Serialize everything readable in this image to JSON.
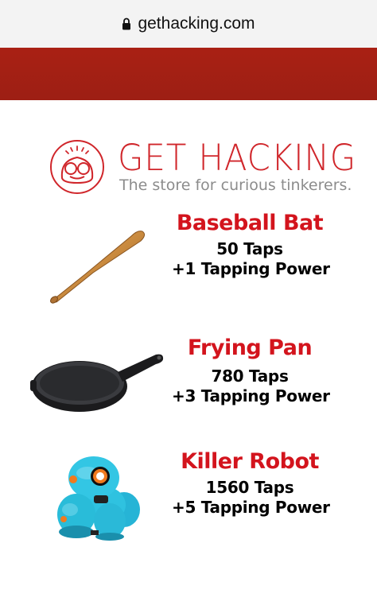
{
  "browser": {
    "url": "gethacking.com",
    "lock_icon": "lock-icon"
  },
  "header": {
    "bar_color": "#a21f15"
  },
  "logo": {
    "title": "GET HACKING",
    "tagline": "The store for curious tinkerers.",
    "color": "#d0262b"
  },
  "items": [
    {
      "name": "Baseball Bat",
      "taps": "50 Taps",
      "power": "+1 Tapping Power",
      "icon": "baseball-bat-icon"
    },
    {
      "name": "Frying Pan",
      "taps": "780 Taps",
      "power": "+3 Tapping Power",
      "icon": "frying-pan-icon"
    },
    {
      "name": "Killer Robot",
      "taps": "1560 Taps",
      "power": "+5 Tapping Power",
      "icon": "robot-icon"
    }
  ],
  "colors": {
    "item_name": "#d3141d",
    "item_text": "#000000"
  }
}
